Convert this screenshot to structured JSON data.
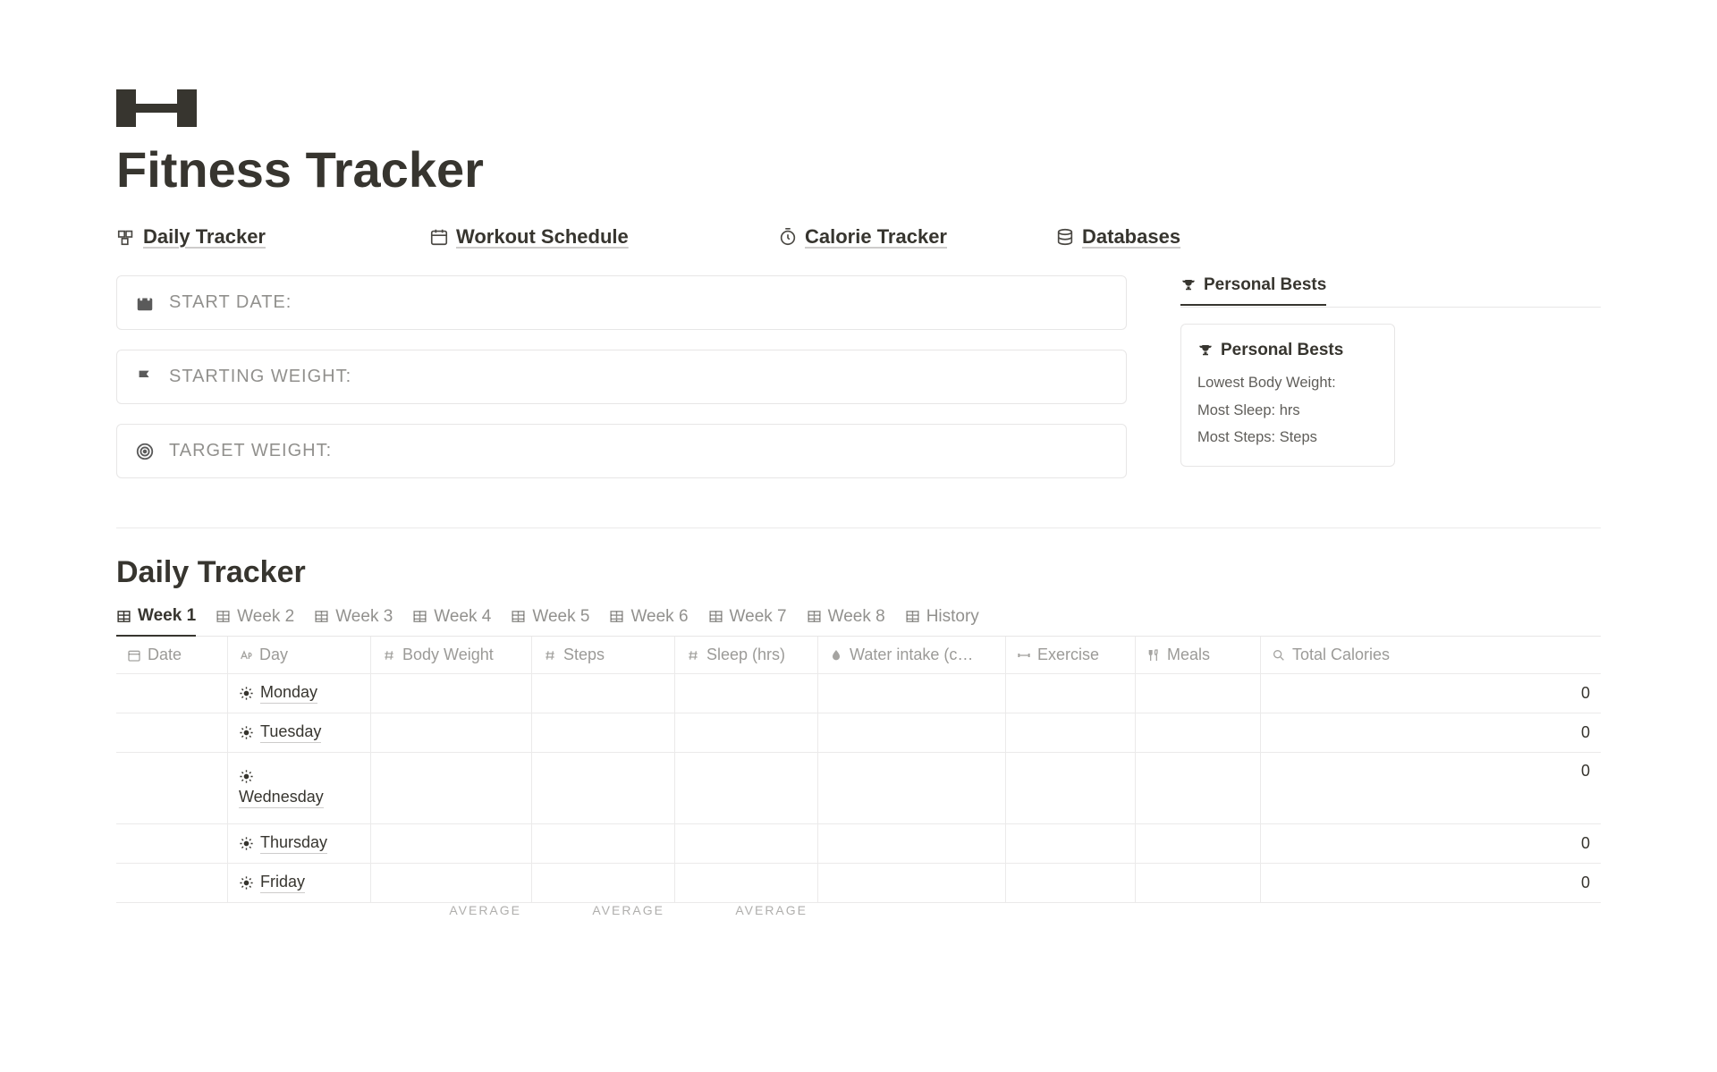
{
  "page": {
    "title": "Fitness Tracker"
  },
  "nav": {
    "daily": "Daily Tracker",
    "workout": "Workout Schedule",
    "calorie": "Calorie Tracker",
    "databases": "Databases"
  },
  "callouts": {
    "start_date": "START DATE:",
    "starting_weight": "STARTING WEIGHT:",
    "target_weight": "TARGET WEIGHT:"
  },
  "pb": {
    "tab_label": "Personal Bests",
    "card_title": "Personal Bests",
    "lowest_body_weight": "Lowest Body Weight:",
    "most_sleep": "Most Sleep: hrs",
    "most_steps": "Most Steps: Steps"
  },
  "section": {
    "daily_tracker_title": "Daily Tracker"
  },
  "tabs": {
    "w1": "Week 1",
    "w2": "Week 2",
    "w3": "Week 3",
    "w4": "Week 4",
    "w5": "Week 5",
    "w6": "Week 6",
    "w7": "Week 7",
    "w8": "Week 8",
    "history": "History"
  },
  "cols": {
    "date": "Date",
    "day": "Day",
    "body_weight": "Body Weight",
    "steps": "Steps",
    "sleep": "Sleep (hrs)",
    "water": "Water intake (c…",
    "exercise": "Exercise",
    "meals": "Meals",
    "total_cal": "Total Calories"
  },
  "rows": [
    {
      "day": "Monday",
      "total_cal": "0"
    },
    {
      "day": "Tuesday",
      "total_cal": "0"
    },
    {
      "day": "Wednesday",
      "total_cal": "0"
    },
    {
      "day": "Thursday",
      "total_cal": "0"
    },
    {
      "day": "Friday",
      "total_cal": "0"
    }
  ],
  "footer": {
    "average": "AVERAGE"
  }
}
